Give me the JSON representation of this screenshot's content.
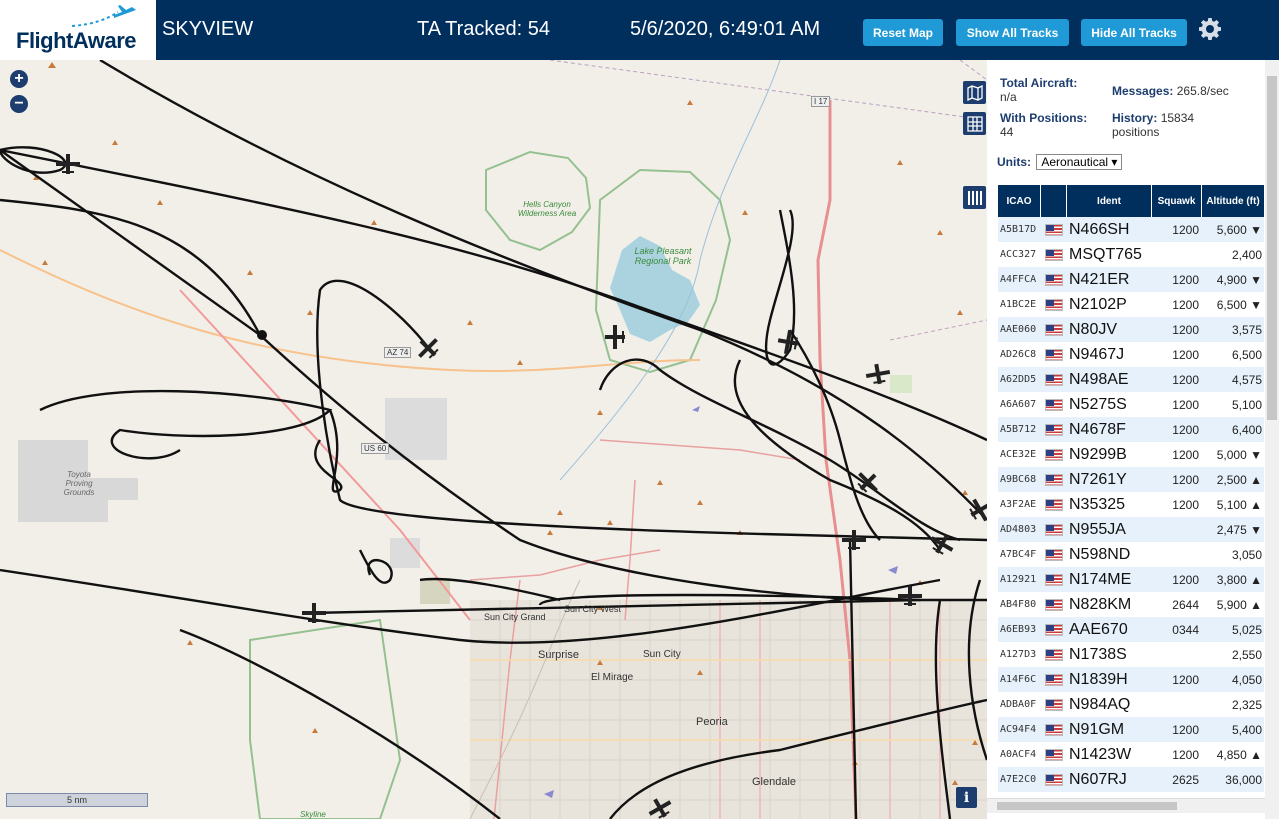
{
  "header": {
    "logo": "FlightAware",
    "title": "SKYVIEW",
    "ta_tracked": "TA Tracked: 54",
    "datetime": "5/6/2020, 6:49:01 AM",
    "reset_map": "Reset Map",
    "show_all_tracks": "Show All Tracks",
    "hide_all_tracks": "Hide All Tracks"
  },
  "map": {
    "scale": "5 nm",
    "places": {
      "surprise": "Surprise",
      "sun_city": "Sun City",
      "sun_city_west": "Sun City West",
      "sun_city_grand": "Sun City Grand",
      "el_mirage": "El Mirage",
      "peoria": "Peoria",
      "glendale": "Glendale",
      "skyline": "Skyline"
    },
    "parks": {
      "hells_canyon": "Hells Canyon Wilderness Area",
      "lake_pleasant": "Lake Pleasant Regional Park",
      "toyota": "Toyota Proving Grounds"
    },
    "roads": {
      "az74": "AZ 74",
      "us60": "US 60",
      "i17": "I 17"
    }
  },
  "stats": {
    "total_aircraft_label": "Total Aircraft:",
    "total_aircraft_value": "n/a",
    "with_positions_label": "With Positions:",
    "with_positions_value": "44",
    "messages_label": "Messages:",
    "messages_value": "265.8/sec",
    "history_label": "History:",
    "history_value": "15834",
    "history_unit": "positions"
  },
  "units": {
    "label": "Units:",
    "value": "Aeronautical"
  },
  "table": {
    "headers": {
      "icao": "ICAO",
      "ident": "Ident",
      "squawk": "Squawk",
      "altitude": "Altitude (ft)"
    },
    "rows": [
      {
        "icao": "A5B17D",
        "ident": "N466SH",
        "squawk": "1200",
        "alt": "5,600 ▼"
      },
      {
        "icao": "ACC327",
        "ident": "MSQT765",
        "squawk": "",
        "alt": "2,400"
      },
      {
        "icao": "A4FFCA",
        "ident": "N421ER",
        "squawk": "1200",
        "alt": "4,900 ▼"
      },
      {
        "icao": "A1BC2E",
        "ident": "N2102P",
        "squawk": "1200",
        "alt": "6,500 ▼"
      },
      {
        "icao": "AAE060",
        "ident": "N80JV",
        "squawk": "1200",
        "alt": "3,575"
      },
      {
        "icao": "AD26C8",
        "ident": "N9467J",
        "squawk": "1200",
        "alt": "6,500"
      },
      {
        "icao": "A62DD5",
        "ident": "N498AE",
        "squawk": "1200",
        "alt": "4,575"
      },
      {
        "icao": "A6A607",
        "ident": "N5275S",
        "squawk": "1200",
        "alt": "5,100"
      },
      {
        "icao": "A5B712",
        "ident": "N4678F",
        "squawk": "1200",
        "alt": "6,400"
      },
      {
        "icao": "ACE32E",
        "ident": "N9299B",
        "squawk": "1200",
        "alt": "5,000 ▼"
      },
      {
        "icao": "A9BC68",
        "ident": "N7261Y",
        "squawk": "1200",
        "alt": "2,500 ▲"
      },
      {
        "icao": "A3F2AE",
        "ident": "N35325",
        "squawk": "1200",
        "alt": "5,100 ▲"
      },
      {
        "icao": "AD4803",
        "ident": "N955JA",
        "squawk": "",
        "alt": "2,475 ▼"
      },
      {
        "icao": "A7BC4F",
        "ident": "N598ND",
        "squawk": "",
        "alt": "3,050"
      },
      {
        "icao": "A12921",
        "ident": "N174ME",
        "squawk": "1200",
        "alt": "3,800 ▲"
      },
      {
        "icao": "AB4F80",
        "ident": "N828KM",
        "squawk": "2644",
        "alt": "5,900 ▲"
      },
      {
        "icao": "A6EB93",
        "ident": "AAE670",
        "squawk": "0344",
        "alt": "5,025"
      },
      {
        "icao": "A127D3",
        "ident": "N1738S",
        "squawk": "",
        "alt": "2,550"
      },
      {
        "icao": "A14F6C",
        "ident": "N1839H",
        "squawk": "1200",
        "alt": "4,050"
      },
      {
        "icao": "ADBA0F",
        "ident": "N984AQ",
        "squawk": "",
        "alt": "2,325"
      },
      {
        "icao": "AC94F4",
        "ident": "N91GM",
        "squawk": "1200",
        "alt": "5,400"
      },
      {
        "icao": "A0ACF4",
        "ident": "N1423W",
        "squawk": "1200",
        "alt": "4,850 ▲"
      },
      {
        "icao": "A7E2C0",
        "ident": "N607RJ",
        "squawk": "2625",
        "alt": "36,000"
      }
    ]
  },
  "colors": {
    "header_bg": "#002f5d",
    "button": "#1f9ad6",
    "row_alt": "#e6f1fb",
    "track": "#111111"
  }
}
